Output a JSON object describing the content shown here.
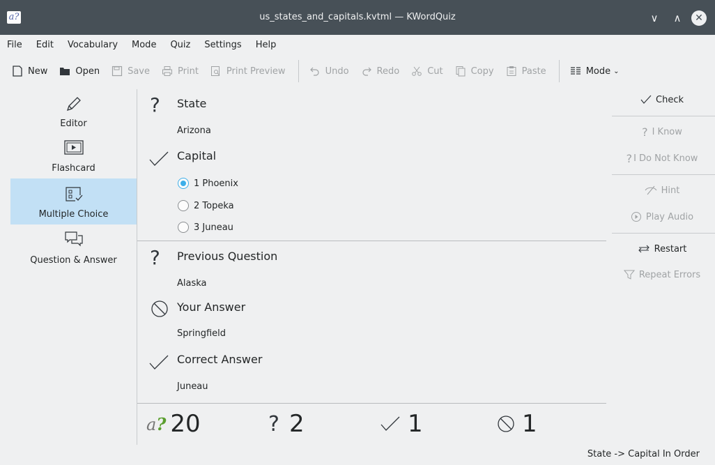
{
  "window": {
    "title": "us_states_and_capitals.kvtml — KWordQuiz",
    "app_icon_text": "a?"
  },
  "menu": [
    "File",
    "Edit",
    "Vocabulary",
    "Mode",
    "Quiz",
    "Settings",
    "Help"
  ],
  "toolbar": {
    "new": "New",
    "open": "Open",
    "save": "Save",
    "print": "Print",
    "print_preview": "Print Preview",
    "undo": "Undo",
    "redo": "Redo",
    "cut": "Cut",
    "copy": "Copy",
    "paste": "Paste",
    "mode": "Mode"
  },
  "modes": {
    "editor": "Editor",
    "flashcard": "Flashcard",
    "multiple_choice": "Multiple Choice",
    "question_answer": "Question & Answer"
  },
  "quiz": {
    "question_label": "State",
    "question_value": "Arizona",
    "answer_label": "Capital",
    "choices": [
      "1 Phoenix",
      "2 Topeka",
      "3 Juneau"
    ],
    "selected_choice": 0,
    "previous_question_label": "Previous Question",
    "previous_question_value": "Alaska",
    "your_answer_label": "Your Answer",
    "your_answer_value": "Springfield",
    "correct_answer_label": "Correct Answer",
    "correct_answer_value": "Juneau"
  },
  "score": {
    "total": "20",
    "questions": "2",
    "correct": "1",
    "errors": "1"
  },
  "actions": {
    "check": "Check",
    "i_know": "I Know",
    "i_do_not_know": "I Do Not Know",
    "hint": "Hint",
    "play_audio": "Play Audio",
    "restart": "Restart",
    "repeat_errors": "Repeat Errors"
  },
  "status": "State -> Capital In Order"
}
